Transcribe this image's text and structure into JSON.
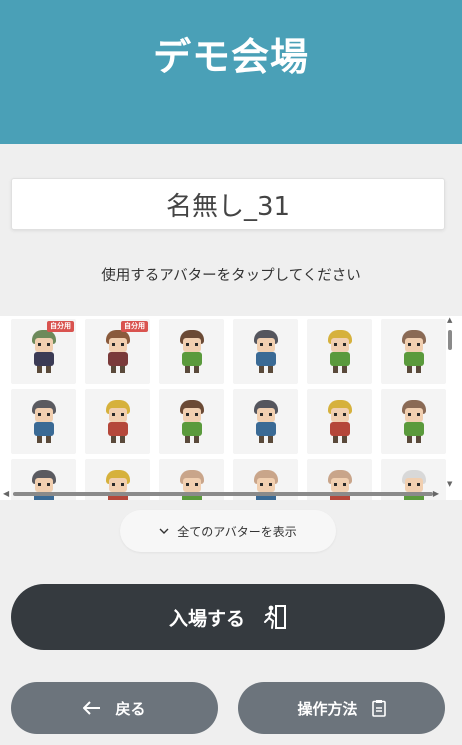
{
  "header": {
    "title": "デモ会場"
  },
  "name_input": {
    "value": "名無し_31"
  },
  "instruction": "使用するアバターをタップしてください",
  "avatar_grid": {
    "badge_label": "自分用",
    "avatars": [
      {
        "hair": "#6d8a5b",
        "body": "#3b3b55",
        "badge": true
      },
      {
        "hair": "#8a5a3c",
        "body": "#7a3a3a",
        "badge": true
      },
      {
        "hair": "#6b4a35",
        "body": "#5a9a3c",
        "badge": false
      },
      {
        "hair": "#55565e",
        "body": "#3a6a95",
        "badge": false
      },
      {
        "hair": "#d6b13c",
        "body": "#5a9a3c",
        "badge": false
      },
      {
        "hair": "#8a6a55",
        "body": "#5a9a3c",
        "badge": false
      },
      {
        "hair": "#5a5a60",
        "body": "#3a6a95",
        "badge": false
      },
      {
        "hair": "#d6b13c",
        "body": "#b5473a",
        "badge": false
      },
      {
        "hair": "#6b4a35",
        "body": "#5a9a3c",
        "badge": false
      },
      {
        "hair": "#55565e",
        "body": "#3a6a95",
        "badge": false
      },
      {
        "hair": "#d6b13c",
        "body": "#b5473a",
        "badge": false
      },
      {
        "hair": "#8a6a55",
        "body": "#5a9a3c",
        "badge": false
      },
      {
        "hair": "#5a5a60",
        "body": "#3a6a95",
        "badge": false
      },
      {
        "hair": "#d6b13c",
        "body": "#b5473a",
        "badge": false
      },
      {
        "hair": "#c9a58a",
        "body": "#5a9a3c",
        "badge": false
      },
      {
        "hair": "#c9a58a",
        "body": "#3a6a95",
        "badge": false
      },
      {
        "hair": "#c9a58a",
        "body": "#b5473a",
        "badge": false
      },
      {
        "hair": "#d8d8d8",
        "body": "#5a9a3c",
        "badge": false
      }
    ]
  },
  "show_all_button": {
    "label": "全てのアバターを表示",
    "icon": "chevron-down-icon"
  },
  "enter_button": {
    "label": "入場する",
    "icon": "enter-door-icon"
  },
  "back_button": {
    "label": "戻る",
    "icon": "arrow-left-icon"
  },
  "help_button": {
    "label": "操作方法",
    "icon": "clipboard-icon"
  },
  "colors": {
    "header_bg": "#4aa0b7",
    "primary_button": "#353a3f",
    "secondary_button": "#6c747c",
    "badge": "#d9534f"
  }
}
